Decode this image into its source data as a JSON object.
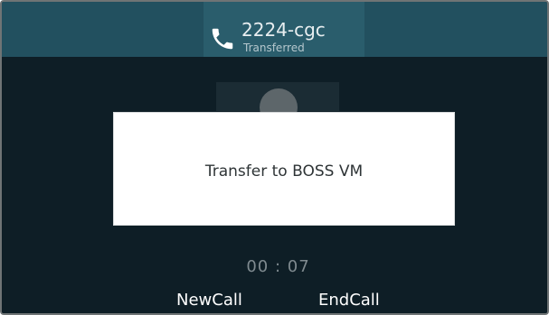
{
  "call": {
    "title": "2224-cgc",
    "status": "Transferred",
    "icon": "phone-icon"
  },
  "dialog": {
    "message": "Transfer to BOSS VM"
  },
  "timer": {
    "text": "00 : 07"
  },
  "softkeys": {
    "new_call": "NewCall",
    "end_call": "EndCall"
  },
  "colors": {
    "header_bg": "#22505f",
    "main_bg": "#0e1e26",
    "dialog_bg": "#ffffff",
    "icon": "#ffffff"
  }
}
